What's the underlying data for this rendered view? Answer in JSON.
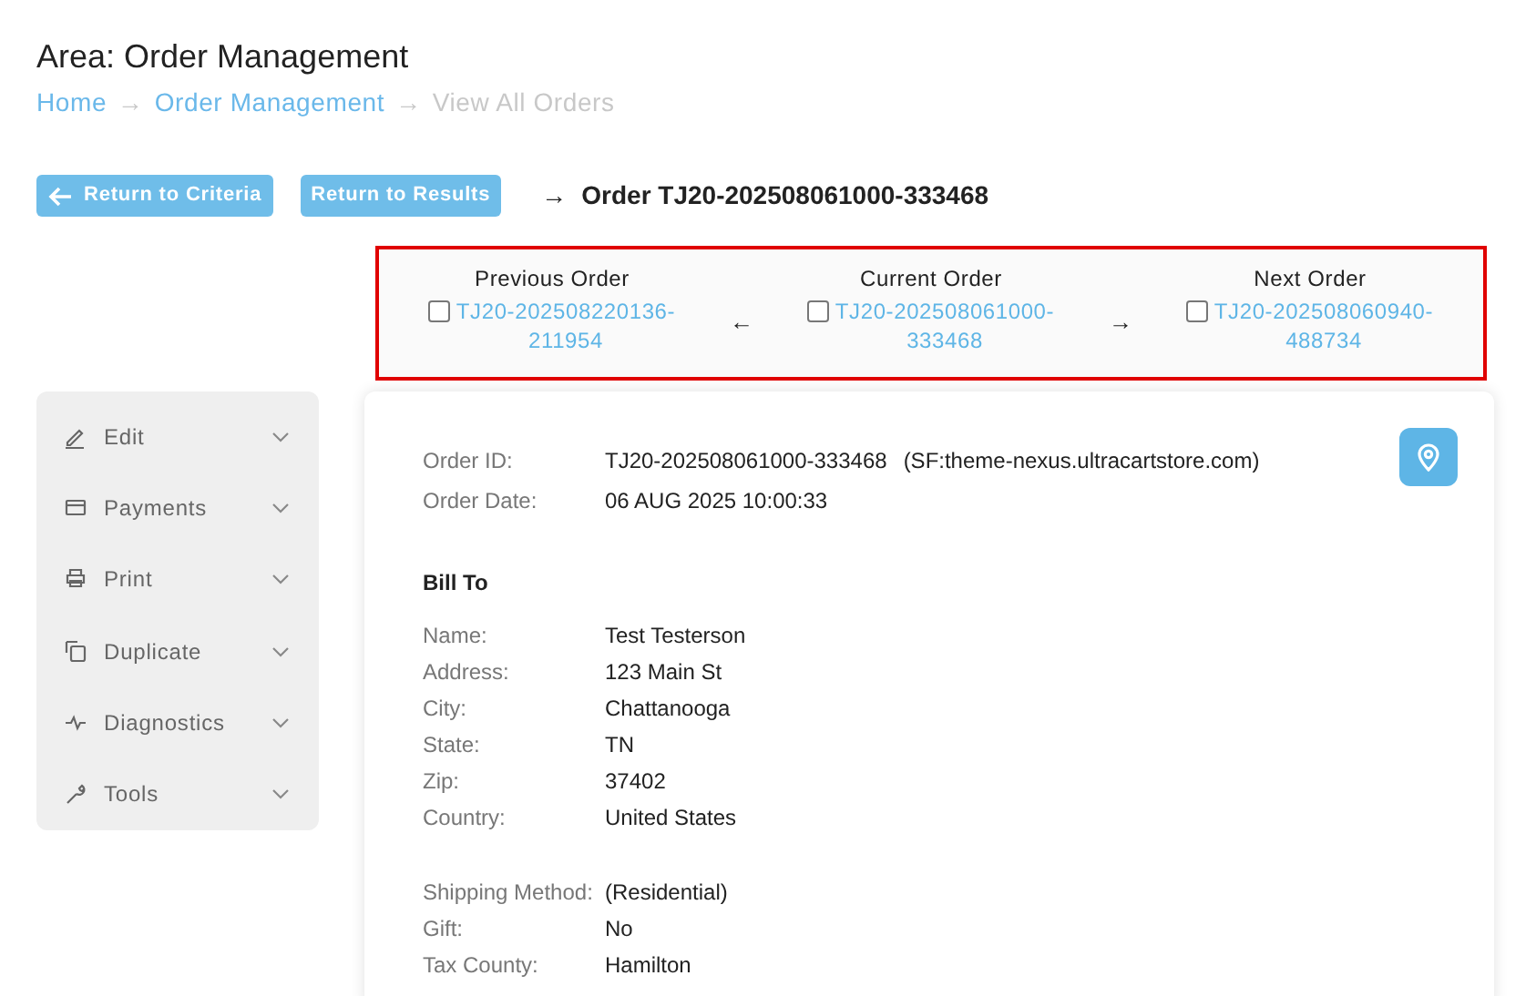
{
  "area_title": "Area: Order Management",
  "breadcrumb": [
    {
      "label": "Home",
      "current": false
    },
    {
      "label": "Order Management",
      "current": false
    },
    {
      "label": "View All Orders",
      "current": true
    }
  ],
  "breadcrumb_separator": "→",
  "buttons": [
    {
      "label": "Return to Criteria",
      "kind": "back"
    },
    {
      "label": "Return to Results",
      "kind": "plain"
    }
  ],
  "order_heading": {
    "arrow": "→",
    "title": "Order TJ20-202508061000-333468"
  },
  "order_nav": [
    {
      "heading": "Previous Order",
      "checked": false,
      "order": "TJ20-202508220136-211954",
      "arrow": "←"
    },
    {
      "heading": "Current Order",
      "checked": false,
      "order": "TJ20-202508061000-333468",
      "arrow": "→"
    },
    {
      "heading": "Next Order",
      "checked": false,
      "order": "TJ20-202508060940-488734"
    }
  ],
  "sidebar": [
    {
      "label": "Edit",
      "kind": "pencil",
      "expanded": false
    },
    {
      "label": "Payments",
      "kind": "card",
      "expanded": false
    },
    {
      "label": "Print",
      "kind": "printer",
      "expanded": false
    },
    {
      "label": "Duplicate",
      "kind": "copy",
      "expanded": false
    },
    {
      "label": "Diagnostics",
      "kind": "pulse",
      "expanded": false
    },
    {
      "label": "Tools",
      "kind": "wrench",
      "expanded": false
    }
  ],
  "order_info": [
    {
      "label": "Order ID:",
      "value": "TJ20-202508061000-333468",
      "extra": "(SF:theme-nexus.ultracartstore.com)"
    },
    {
      "label": "Order Date:",
      "value": "06 AUG 2025 10:00:33"
    }
  ],
  "bill_to": {
    "heading": "Bill To",
    "fields": [
      {
        "label": "Name:",
        "value": "Test Testerson"
      },
      {
        "label": "Address:",
        "value": "123 Main St"
      },
      {
        "label": "City:",
        "value": "Chattanooga"
      },
      {
        "label": "State:",
        "value": "TN"
      },
      {
        "label": "Zip:",
        "value": "37402"
      },
      {
        "label": "Country:",
        "value": "United States"
      }
    ]
  },
  "shipping": [
    {
      "label": "Shipping Method:",
      "value": "(Residential)"
    },
    {
      "label": "Gift:",
      "value": "No"
    },
    {
      "label": "Tax County:",
      "value": "Hamilton"
    }
  ]
}
